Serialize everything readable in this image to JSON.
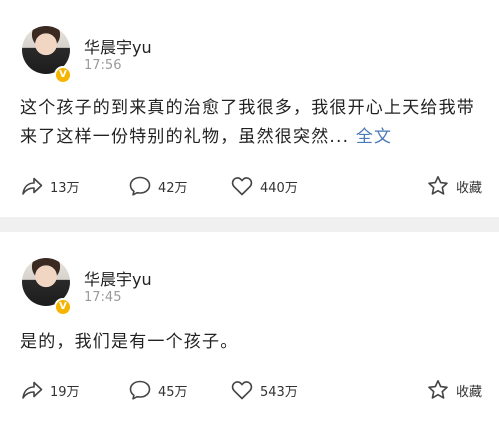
{
  "posts": [
    {
      "author": "华晨宇yu",
      "time": "17:56",
      "text": "这个孩子的到来真的治愈了我很多，我很开心上天给我带来了这样一份特别的礼物，虽然很突然... ",
      "more_link": "全文",
      "shares": "13万",
      "comments": "42万",
      "likes": "440万",
      "favorite_label": "收藏",
      "badge": "V"
    },
    {
      "author": "华晨宇yu",
      "time": "17:45",
      "text": "是的，我们是有一个孩子。",
      "shares": "19万",
      "comments": "45万",
      "likes": "543万",
      "favorite_label": "收藏",
      "badge": "V"
    }
  ],
  "icons": {
    "share": "share-icon",
    "comment": "comment-icon",
    "like": "heart-icon",
    "favorite": "star-icon",
    "verified": "verified-badge-icon"
  },
  "colors": {
    "background": "#f0f0f0",
    "card": "#ffffff",
    "link": "#4a7ab8",
    "muted": "#9a9a9a",
    "badge": "#f6b300"
  }
}
